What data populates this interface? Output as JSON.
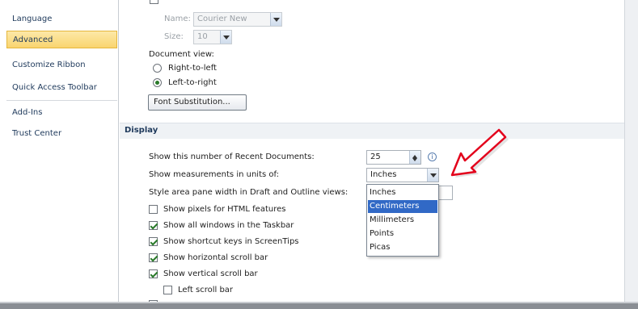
{
  "sidebar": {
    "items": [
      {
        "label": "Language",
        "active": false
      },
      {
        "label": "Advanced",
        "active": true
      },
      {
        "label": "Customize Ribbon",
        "active": false
      },
      {
        "label": "Quick Access Toolbar",
        "active": false
      },
      {
        "label": "Add-Ins",
        "active": false
      },
      {
        "label": "Trust Center",
        "active": false
      }
    ]
  },
  "draft": {
    "name_label": "Name:",
    "name_value": "Courier New",
    "size_label": "Size:",
    "size_value": "10",
    "document_view_label": "Document view:",
    "rtl_label": "Right-to-left",
    "ltr_label": "Left-to-right",
    "font_substitution_label": "Font Substitution..."
  },
  "display": {
    "header": "Display",
    "recent_docs_label": "Show this number of Recent Documents:",
    "recent_docs_value": "25",
    "info_glyph": "i",
    "units_label": "Show measurements in units of:",
    "units_value": "Inches",
    "style_area_label": "Style area pane width in Draft and Outline views:",
    "units_options": [
      "Inches",
      "Centimeters",
      "Millimeters",
      "Points",
      "Picas"
    ],
    "selected_option": "Centimeters",
    "checkboxes": [
      {
        "label": "Show pixels for HTML features",
        "checked": false
      },
      {
        "label": "Show all windows in the Taskbar",
        "checked": true
      },
      {
        "label": "Show shortcut keys in ScreenTips",
        "checked": true
      },
      {
        "label": "Show horizontal scroll bar",
        "checked": true
      },
      {
        "label": "Show vertical scroll bar",
        "checked": true
      },
      {
        "label": "Left scroll bar",
        "checked": false
      }
    ]
  },
  "colors": {
    "accent_arrow": "#e3001b",
    "active_tab": "#f9d46f",
    "selection": "#3169c6"
  }
}
